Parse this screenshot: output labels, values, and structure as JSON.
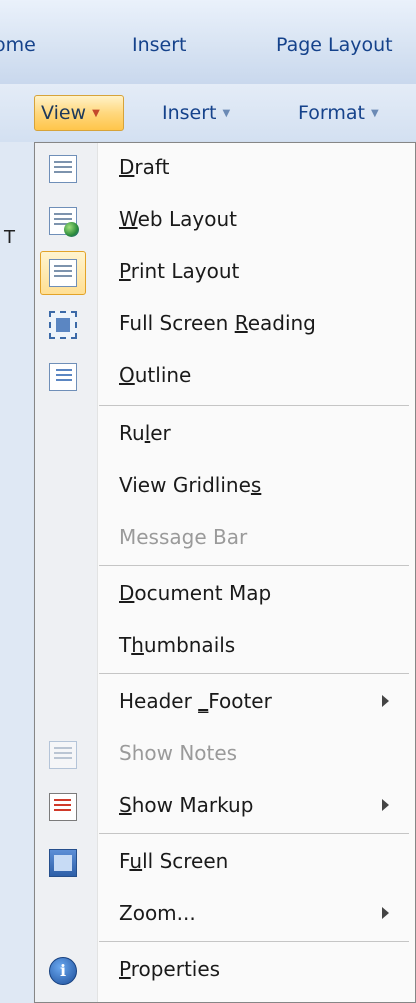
{
  "ribbon": {
    "tabs": [
      "ome",
      "Insert",
      "Page Layout"
    ]
  },
  "commandbar": {
    "view": "View",
    "insert": "Insert",
    "format": "Format"
  },
  "document": {
    "visible_char": "T"
  },
  "menu": {
    "items": [
      {
        "pre": "",
        "u": "D",
        "post": "raft",
        "icon": "draft-page-icon"
      },
      {
        "pre": "",
        "u": "W",
        "post": "eb Layout",
        "icon": "web-layout-icon"
      },
      {
        "pre": "",
        "u": "P",
        "post": "rint Layout",
        "icon": "print-layout-icon",
        "checked": true
      },
      {
        "pre": "Full Screen ",
        "u": "R",
        "post": "eading",
        "icon": "full-screen-reading-icon"
      },
      {
        "pre": "",
        "u": "O",
        "post": "utline",
        "icon": "outline-icon"
      },
      {
        "pre": "Ru",
        "u": "l",
        "post": "er"
      },
      {
        "pre": "View Gridline",
        "u": "s",
        "post": ""
      },
      {
        "pre": "Message Bar",
        "u": "",
        "post": "",
        "disabled": true
      },
      {
        "pre": "",
        "u": "D",
        "post": "ocument Map"
      },
      {
        "pre": "T",
        "u": "h",
        "post": "umbnails"
      },
      {
        "pre": "Header ",
        "u": "_",
        "post": "Footer",
        "submenu": true
      },
      {
        "pre": "Show Notes",
        "u": "",
        "post": "",
        "disabled": true,
        "icon": "show-notes-icon"
      },
      {
        "pre": "",
        "u": "S",
        "post": "how Markup",
        "submenu": true,
        "icon": "show-markup-icon"
      },
      {
        "pre": "F",
        "u": "u",
        "post": "ll Screen",
        "icon": "full-screen-icon"
      },
      {
        "pre": "Zoom...",
        "u": "",
        "post": "",
        "submenu": true
      },
      {
        "pre": "",
        "u": "P",
        "post": "roperties",
        "icon": "properties-icon"
      }
    ]
  },
  "colors": {
    "accent_highlight": "#ffd87e",
    "ribbon_text": "#15428b"
  }
}
